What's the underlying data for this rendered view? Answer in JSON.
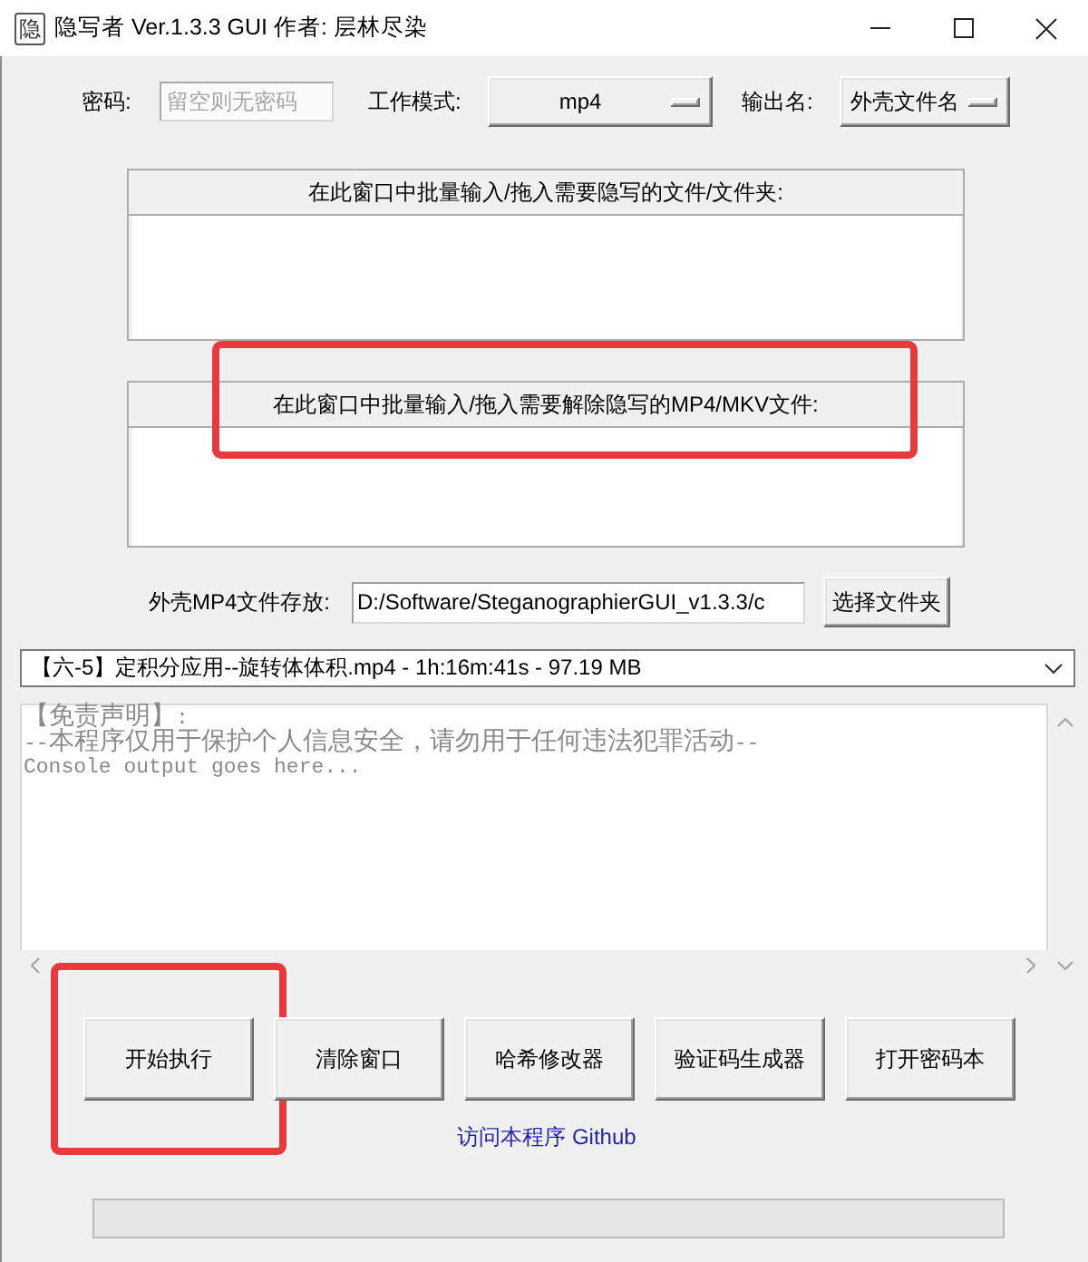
{
  "window": {
    "title": "隐写者 Ver.1.3.3 GUI 作者: 层林尽染",
    "icon_glyph": "隐"
  },
  "settings": [
    {
      "kind": "field",
      "label": "密码:",
      "placeholder": "留空则无密码"
    },
    {
      "kind": "option_menu",
      "label": "工作模式:",
      "value": "mp4"
    },
    {
      "kind": "option_menu",
      "label": "输出名:",
      "value": "外壳文件名"
    }
  ],
  "drop_zones": [
    {
      "heading": "在此窗口中批量输入/拖入需要隐写的文件/文件夹:",
      "highlighted": false
    },
    {
      "heading": "在此窗口中批量输入/拖入需要解除隐写的MP4/MKV文件:",
      "highlighted": true
    }
  ],
  "output_folder": {
    "label": "外壳MP4文件存放:",
    "value": "D:/Software/SteganographierGUI_v1.3.3/c",
    "button": "选择文件夹"
  },
  "file_select": {
    "value": "【六-5】定积分应用--旋转体体积.mp4 - 1h:16m:41s - 97.19 MB"
  },
  "console": {
    "lines": [
      "【免责声明】:",
      "--本程序仅用于保护个人信息安全，请勿用于任何违法犯罪活动--",
      "Console output goes here..."
    ]
  },
  "actions": [
    {
      "label": "开始执行",
      "highlighted": true
    },
    {
      "label": "清除窗口",
      "highlighted": false
    },
    {
      "label": "哈希修改器",
      "highlighted": false
    },
    {
      "label": "验证码生成器",
      "highlighted": false
    },
    {
      "label": "打开密码本",
      "highlighted": false
    }
  ],
  "link": "访问本程序 Github",
  "progress": {
    "level": 0
  }
}
